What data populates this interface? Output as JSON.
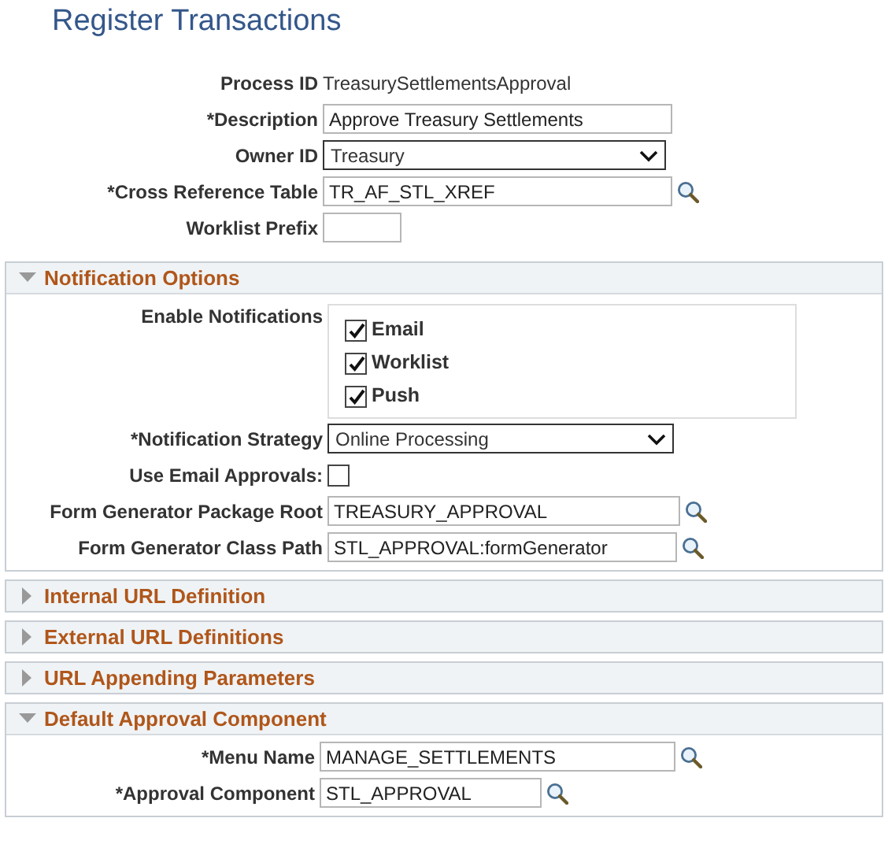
{
  "title": "Register Transactions",
  "fields": [
    {
      "kind": "text",
      "label": "Process ID",
      "value": "TreasurySettlementsApproval"
    },
    {
      "kind": "input",
      "label": "*Description",
      "value": "Approve Treasury Settlements"
    },
    {
      "kind": "select",
      "label": "Owner ID",
      "value": "Treasury"
    },
    {
      "kind": "lookup",
      "label": "*Cross Reference Table",
      "value": "TR_AF_STL_XREF"
    },
    {
      "kind": "input",
      "label": "Worklist Prefix"
    }
  ],
  "sections": [
    {
      "title": "Notification Options",
      "expanded": true,
      "fields": [
        {
          "kind": "checkgroup",
          "label": "Enable Notifications",
          "options": [
            {
              "label": "Email",
              "checked": true
            },
            {
              "label": "Worklist",
              "checked": true
            },
            {
              "label": "Push",
              "checked": true
            }
          ]
        },
        {
          "kind": "select",
          "label": "*Notification Strategy",
          "value": "Online Processing"
        },
        {
          "kind": "checkbox",
          "label": "Use Email Approvals:",
          "checked": false
        },
        {
          "kind": "lookup",
          "label": "Form Generator Package Root",
          "value": "TREASURY_APPROVAL"
        },
        {
          "kind": "lookup",
          "label": "Form Generator Class Path",
          "value": "STL_APPROVAL:formGenerator"
        }
      ]
    },
    {
      "title": "Internal URL Definition",
      "expanded": false
    },
    {
      "title": "External URL Definitions",
      "expanded": false
    },
    {
      "title": "URL Appending Parameters",
      "expanded": false
    },
    {
      "title": "Default Approval Component",
      "expanded": true,
      "fields": [
        {
          "kind": "lookup",
          "label": "*Menu Name",
          "value": "MANAGE_SETTLEMENTS"
        },
        {
          "kind": "lookup",
          "label": "*Approval Component",
          "value": "STL_APPROVAL"
        }
      ]
    }
  ]
}
